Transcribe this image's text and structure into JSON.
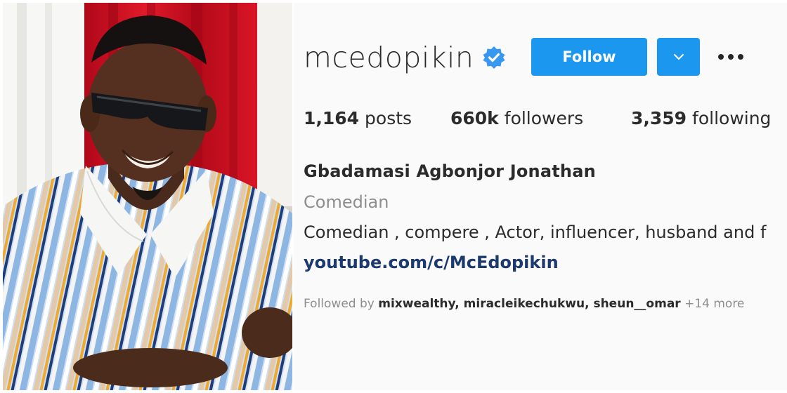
{
  "profile": {
    "username": "mcedopikin",
    "verified": true,
    "follow_label": "Follow",
    "stats": {
      "posts_count": "1,164",
      "posts_label": "posts",
      "followers_count": "660k",
      "followers_label": "followers",
      "following_count": "3,359",
      "following_label": "following"
    },
    "full_name": "Gbadamasi Agbonjor Jonathan",
    "category": "Comedian",
    "bio": "Comedian , compere , Actor, influencer, husband and f",
    "link": "youtube.com/c/McEdopikin",
    "followed_by": {
      "prefix": "Followed by",
      "names": "mixwealthy, miracleikechukwu, sheun__omar",
      "more": "+14 more"
    }
  },
  "icons": {
    "verified": "verified-badge-icon",
    "dropdown": "chevron-down-icon",
    "more": "more-options-icon"
  },
  "colors": {
    "accent": "#1c97f0",
    "link": "#1d3a6e",
    "muted": "#8e8e8e",
    "text": "#2b2b2b"
  }
}
